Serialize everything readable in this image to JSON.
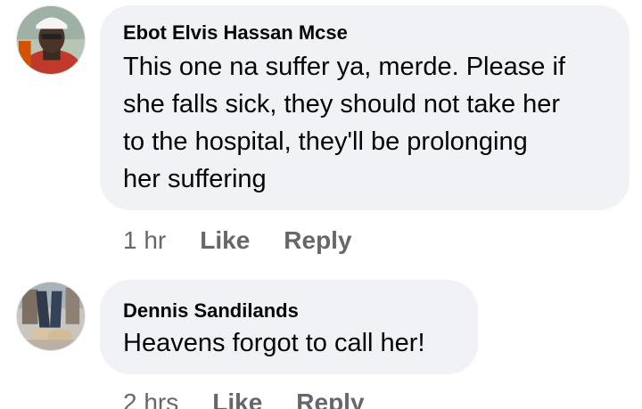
{
  "comments": [
    {
      "author": "Ebot Elvis Hassan Mcse",
      "lines": [
        "This one na suffer ya, merde. Please if",
        "she falls sick, they should not take her",
        "to the hospital, they'll be prolonging",
        "her suffering"
      ],
      "time": "1 hr",
      "like_label": "Like",
      "reply_label": "Reply"
    },
    {
      "author": "Dennis Sandilands",
      "lines": [
        "Heavens forgot to call her!"
      ],
      "time": "2 hrs",
      "like_label": "Like",
      "reply_label": "Reply"
    }
  ],
  "colors": {
    "bubble": "#f0f2f5",
    "text": "#050505",
    "meta": "#65676b"
  }
}
